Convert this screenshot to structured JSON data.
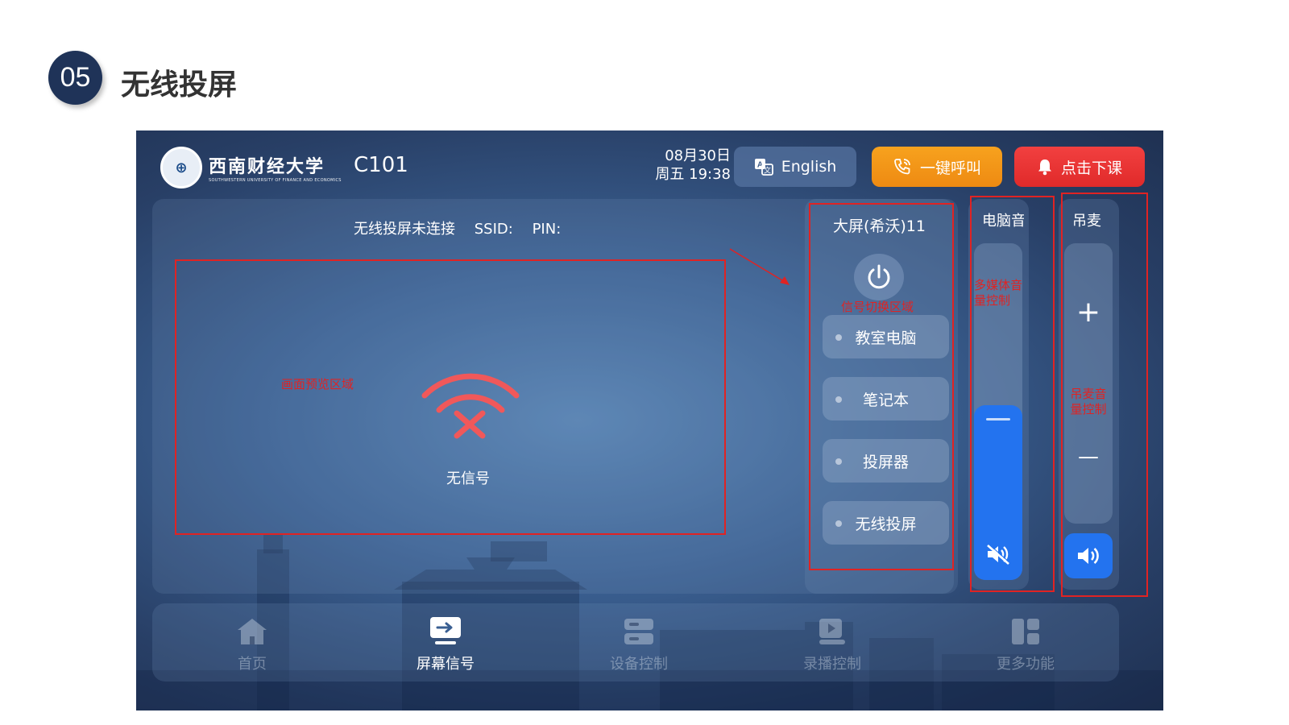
{
  "slide": {
    "number": "05",
    "title": "无线投屏"
  },
  "header": {
    "logo_cn": "西南财经大学",
    "logo_en": "SOUTHWESTERN UNIVERSITY OF FINANCE AND ECONOMICS",
    "room": "C101",
    "date": "08月30日",
    "time": "周五 19:38",
    "english_label": "English",
    "call_label": "一键呼叫",
    "end_class_label": "点击下课"
  },
  "preview": {
    "status": "无线投屏未连接",
    "ssid_label": "SSID:",
    "pin_label": "PIN:",
    "no_signal": "无信号",
    "annotation": "画面预览区域"
  },
  "sources": {
    "title": "大屏(希沃)11",
    "annotation": "信号切换区域",
    "items": [
      {
        "label": "教室电脑"
      },
      {
        "label": "笔记本"
      },
      {
        "label": "投屏器"
      },
      {
        "label": "无线投屏"
      }
    ]
  },
  "pc_volume": {
    "title": "电脑音",
    "annotation_line1": "多媒体音",
    "annotation_line2": "量控制",
    "level": 0.52,
    "muted": true
  },
  "mic": {
    "title": "吊麦",
    "annotation_line1": "吊麦音",
    "annotation_line2": "量控制",
    "plus": "+",
    "minus": "—"
  },
  "nav": [
    {
      "label": "首页",
      "icon": "home-icon",
      "active": false
    },
    {
      "label": "屏幕信号",
      "icon": "screen-signal-icon",
      "active": true
    },
    {
      "label": "设备控制",
      "icon": "device-control-icon",
      "active": false
    },
    {
      "label": "录播控制",
      "icon": "recording-icon",
      "active": false
    },
    {
      "label": "更多功能",
      "icon": "more-icon",
      "active": false
    }
  ],
  "colors": {
    "accent_blue": "#2373ef",
    "call_orange": "#f59a1a",
    "end_red": "#ec3434",
    "annotation_red": "#e02323",
    "no_signal_red": "#f0585a"
  }
}
